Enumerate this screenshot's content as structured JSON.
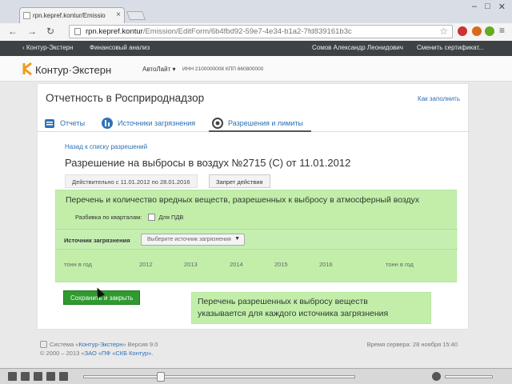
{
  "browser": {
    "tab_title": "rpn.kepref.kontur/Emissio",
    "url_host": "rpn.kepref.kontur",
    "url_path": "/Emission/EditForm/6b4fbd92-59e7-4e34-b1a2-7fd839161b3c",
    "window_controls": [
      "–",
      "□",
      "✕"
    ]
  },
  "appbar": {
    "back_label": "‹ Контур-Экстерн",
    "finance_label": "Финансовый анализ",
    "user_name": "Сомов Александр Леонидович",
    "change_cert_label": "Сменить сертификат..."
  },
  "brand": {
    "logo_text": "Контур·Экстерн",
    "org_name": "АвтоЛайт ▾",
    "inn_kpp": "ИНН 2100000008 КПП 660800000"
  },
  "page": {
    "title": "Отчетность в Росприроднадзор",
    "how_to_fill": "Как заполнить",
    "tabs": [
      {
        "label": "Отчеты"
      },
      {
        "label": "Источники загрязнения"
      },
      {
        "label": "Разрешения и лимиты"
      }
    ],
    "back_link": "Назад к списку разрешений",
    "permit_title": "Разрешение на выбросы в воздух №2715 (С) от 11.01.2012",
    "valid_text": "Действительно с 11.01.2012 по 28.01.2016",
    "ban_button": "Запрет действия"
  },
  "panel": {
    "title": "Перечень и количество вредных веществ, разрешенных к выбросу в атмосферный воздух",
    "quarters_label": "Разбивка по кварталам:",
    "pdv_label": "Для ПДВ",
    "source_label": "Источник загрязнения",
    "source_placeholder": "Выберите источник загрязнения",
    "tons_label": "тонн в год",
    "years": [
      "2012",
      "2013",
      "2014",
      "2015",
      "2016"
    ],
    "tons_label_right": "тонн в год"
  },
  "actions": {
    "save_close": "Сохранить и закрыть"
  },
  "note": {
    "line1": "Перечень разрешенных к выбросу веществ",
    "line2": "указывается для каждого источника загрязнения"
  },
  "footer": {
    "system_prefix": "Система «",
    "system_link": "Контур-Экстерн",
    "system_suffix": "» Версия 9.0",
    "copyright_prefix": "© 2000 – 2013 «",
    "company_link": "ЗАО «ПФ «СКБ Контур»",
    "copyright_suffix": ".",
    "server_time": "Время сервера: 28 ноября 15:40"
  },
  "colors": {
    "accent_blue": "#2b6fb6",
    "dark_bar": "#3d4245",
    "green_highlight": "#aee88d",
    "save_green": "#2f9a2f",
    "logo_orange": "#f39a1e"
  }
}
